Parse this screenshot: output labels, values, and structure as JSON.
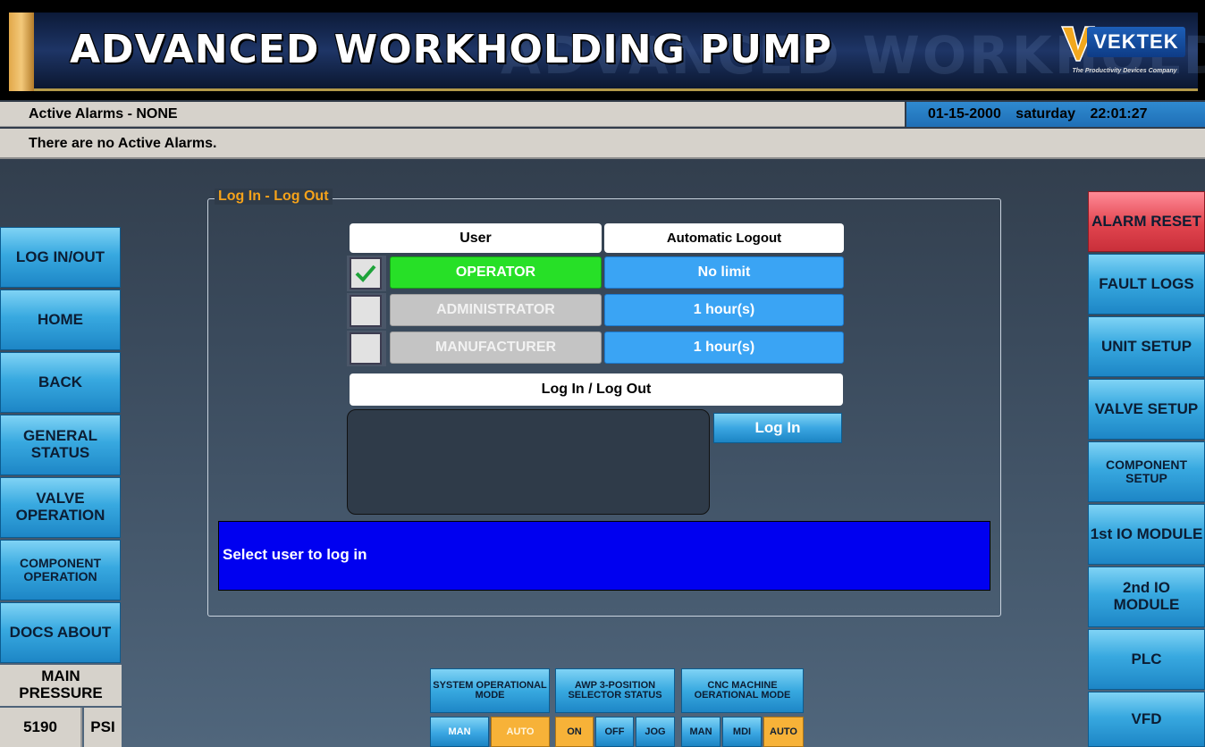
{
  "header": {
    "title": "ADVANCED WORKHOLDING PUMP",
    "brand": "VEKTEK",
    "brand_tagline": "The Productivity Devices Company"
  },
  "alarms": {
    "summary": "Active Alarms - NONE",
    "message": "There are no Active Alarms."
  },
  "datetime": {
    "date": "01-15-2000",
    "day": "saturday",
    "time": "22:01:27"
  },
  "left_nav": [
    {
      "label": "LOG IN/OUT"
    },
    {
      "label": "HOME"
    },
    {
      "label": "BACK"
    },
    {
      "label": "GENERAL STATUS"
    },
    {
      "label": "VALVE OPERATION"
    },
    {
      "label": "COMPONENT OPERATION"
    },
    {
      "label": "DOCS ABOUT"
    }
  ],
  "right_nav": [
    {
      "label": "ALARM RESET"
    },
    {
      "label": "FAULT LOGS"
    },
    {
      "label": "UNIT SETUP"
    },
    {
      "label": "VALVE SETUP"
    },
    {
      "label": "COMPONENT SETUP"
    },
    {
      "label": "1st IO MODULE"
    },
    {
      "label": "2nd IO MODULE"
    },
    {
      "label": "PLC"
    },
    {
      "label": "VFD"
    }
  ],
  "pressure": {
    "label": "MAIN PRESSURE",
    "value": "5190",
    "unit": "PSI"
  },
  "login_panel": {
    "title": "Log In - Log Out",
    "col_user": "User",
    "col_logout": "Automatic Logout",
    "users": [
      {
        "name": "OPERATOR",
        "logout": "No limit",
        "selected": true
      },
      {
        "name": "ADMINISTRATOR",
        "logout": "1 hour(s)",
        "selected": false
      },
      {
        "name": "MANUFACTURER",
        "logout": "1 hour(s)",
        "selected": false
      }
    ],
    "section_label": "Log In / Log Out",
    "login_button": "Log In",
    "status_message": "Select user to log in"
  },
  "status_groups": {
    "system_mode": {
      "label": "SYSTEM OPERATIONAL MODE",
      "options": [
        "MAN",
        "AUTO"
      ]
    },
    "selector": {
      "label": "AWP 3-POSITION SELECTOR STATUS",
      "options": [
        "ON",
        "OFF",
        "JOG"
      ]
    },
    "cnc_mode": {
      "label": "CNC MACHINE OERATIONAL MODE",
      "options": [
        "MAN",
        "MDI",
        "AUTO"
      ]
    }
  },
  "colors": {
    "accent_blue": "#38a9e0",
    "alarm_red": "#e1454f",
    "active_green": "#27e027",
    "status_blue": "#0000f0",
    "legend_orange": "#f5a21a"
  }
}
